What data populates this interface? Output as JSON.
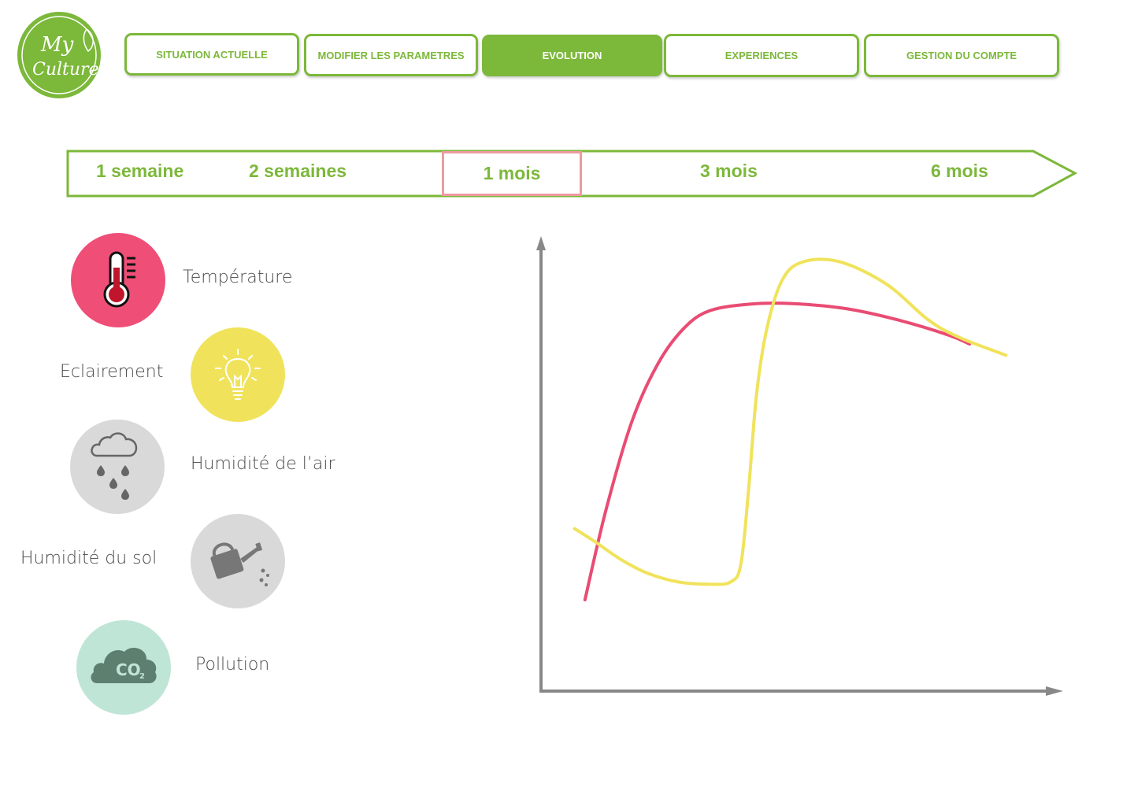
{
  "brand": {
    "logo_line1": "My",
    "logo_line2": "Culture",
    "color": "#7cb83a"
  },
  "nav": {
    "tabs": [
      {
        "label": "SITUATION ACTUELLE",
        "active": false
      },
      {
        "label": "MODIFIER LES PARAMETRES",
        "active": false
      },
      {
        "label": "EVOLUTION",
        "active": true
      },
      {
        "label": "EXPERIENCES",
        "active": false
      },
      {
        "label": "GESTION DU COMPTE",
        "active": false
      }
    ]
  },
  "timeline": {
    "periods": [
      "1 semaine",
      "2 semaines",
      "1 mois",
      "3 mois",
      "6 mois"
    ],
    "selected": "1 mois",
    "selected_color": "#ec9ba0"
  },
  "sensors": [
    {
      "label": "Température",
      "icon": "thermometer-icon",
      "color": "#ef4f77"
    },
    {
      "label": "Eclairement",
      "icon": "lightbulb-icon",
      "color": "#f0e35b"
    },
    {
      "label": "Humidité de l’air",
      "icon": "rain-cloud-icon",
      "color": "#d9d9d9"
    },
    {
      "label": "Humidité du sol",
      "icon": "watering-can-icon",
      "color": "#d9d9d9"
    },
    {
      "label": "Pollution",
      "icon": "co2-cloud-icon",
      "color": "#bfe5d6"
    }
  ],
  "chart_data": {
    "type": "line",
    "title": "",
    "xlabel": "",
    "ylabel": "",
    "xlim": [
      0,
      100
    ],
    "ylim": [
      0,
      100
    ],
    "grid": false,
    "legend": "none",
    "series": [
      {
        "color": "#e94c73",
        "x": [
          8,
          12,
          17,
          22,
          27,
          32,
          40,
          48,
          58,
          68,
          78,
          82
        ],
        "y": [
          20,
          40,
          60,
          73,
          81,
          85,
          86.5,
          86.6,
          85.5,
          83,
          79.5,
          77.5
        ]
      },
      {
        "color": "#f0e35b",
        "x": [
          6,
          10,
          15,
          20,
          26,
          32,
          36,
          38,
          39.5,
          41,
          43,
          46,
          50,
          57,
          66,
          74,
          80,
          89
        ],
        "y": [
          36,
          33,
          29,
          26,
          24,
          23.5,
          24,
          28,
          45,
          66,
          81,
          92,
          96,
          96,
          91,
          83,
          79,
          75
        ]
      }
    ]
  }
}
